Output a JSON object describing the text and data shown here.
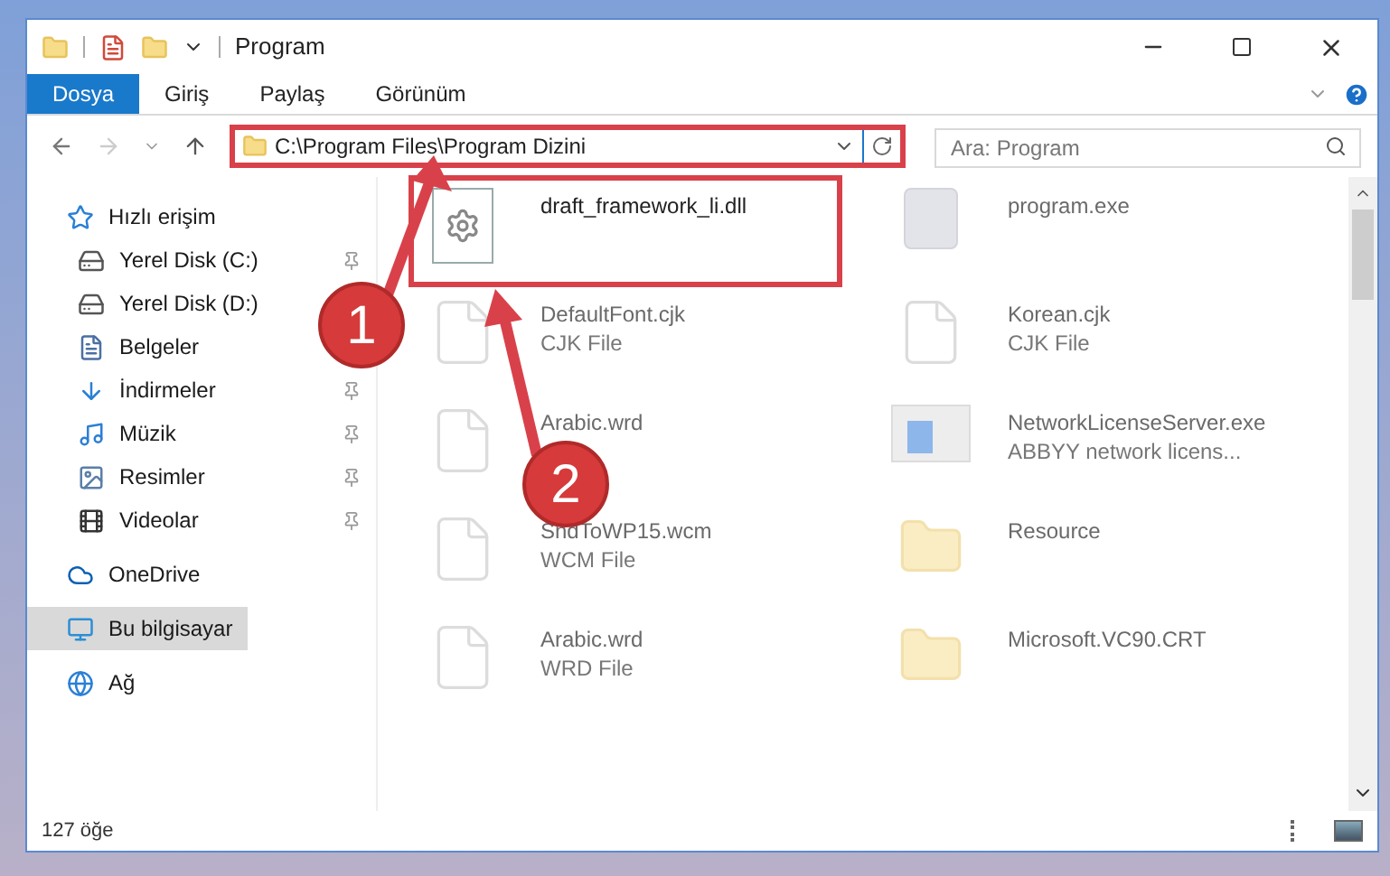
{
  "window": {
    "title": "Program"
  },
  "ribbon": {
    "tabs": [
      {
        "label": "Dosya",
        "selected": true
      },
      {
        "label": "Giriş",
        "selected": false
      },
      {
        "label": "Paylaş",
        "selected": false
      },
      {
        "label": "Görünüm",
        "selected": false
      }
    ]
  },
  "address_bar": {
    "path": "C:\\Program Files\\Program Dizini"
  },
  "search": {
    "placeholder": "Ara: Program"
  },
  "sidebar": {
    "items": [
      {
        "label": "Hızlı erişim",
        "kind": "star",
        "selected": false,
        "children": [
          {
            "label": "Yerel Disk (C:)",
            "kind": "drive-c",
            "selected": false,
            "pinned": true
          },
          {
            "label": "Yerel Disk (D:)",
            "kind": "drive",
            "selected": false
          },
          {
            "label": "Belgeler",
            "kind": "document",
            "selected": false
          },
          {
            "label": "İndirmeler",
            "kind": "download",
            "selected": false,
            "pinned": true
          },
          {
            "label": "Müzik",
            "kind": "music",
            "selected": false,
            "pinned": true
          },
          {
            "label": "Resimler",
            "kind": "picture",
            "selected": false,
            "pinned": true
          },
          {
            "label": "Videolar",
            "kind": "video",
            "selected": false,
            "pinned": true
          }
        ]
      },
      {
        "label": "OneDrive",
        "kind": "cloud",
        "selected": false
      },
      {
        "label": "Bu bilgisayar",
        "kind": "computer",
        "selected": true
      },
      {
        "label": "Ağ",
        "kind": "network",
        "selected": false
      }
    ]
  },
  "files": [
    {
      "name": "draft_framework_li.dll",
      "kind": "dll",
      "faded": false
    },
    {
      "name": "program.exe",
      "kind": "exe",
      "faded": true
    },
    {
      "name": "DefaultFont.cjk",
      "type": "CJK File",
      "kind": "file",
      "faded": true
    },
    {
      "name": "Korean.cjk",
      "type": "CJK File",
      "kind": "file",
      "faded": true
    },
    {
      "name": "Arabic.wrd",
      "kind": "file",
      "faded": true
    },
    {
      "name": "NetworkLicenseServer.exe",
      "type": "ABBYY network licens...",
      "kind": "app",
      "faded": true
    },
    {
      "name": "SndToWP15.wcm",
      "type": "WCM File",
      "kind": "file",
      "faded": true
    },
    {
      "name": "Resource",
      "kind": "folder",
      "faded": true
    },
    {
      "name": "Arabic.wrd",
      "type": "WRD File",
      "kind": "file",
      "faded": true
    },
    {
      "name": "Microsoft.VC90.CRT",
      "kind": "folder",
      "faded": true
    }
  ],
  "status_bar": {
    "count": "127 öğe"
  },
  "annotations": [
    {
      "label": "1"
    },
    {
      "label": "2"
    }
  ]
}
